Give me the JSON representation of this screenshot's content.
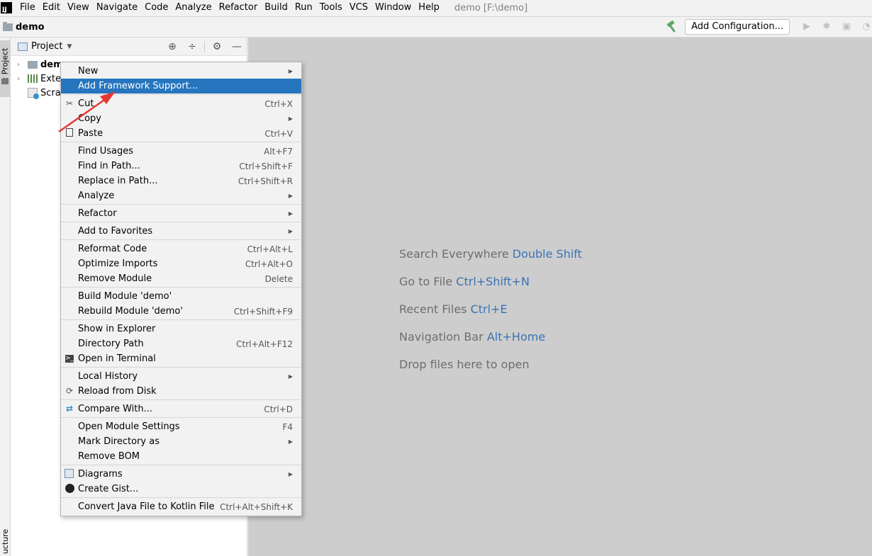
{
  "menubar": {
    "items": [
      "File",
      "Edit",
      "View",
      "Navigate",
      "Code",
      "Analyze",
      "Refactor",
      "Build",
      "Run",
      "Tools",
      "VCS",
      "Window",
      "Help"
    ],
    "window_title": "demo [F:\\demo]"
  },
  "navbar": {
    "crumb": "demo",
    "add_configuration": "Add Configuration..."
  },
  "left_strip": {
    "project_tab": "1: Project",
    "structure_tab": "ucture"
  },
  "project_panel": {
    "title": "Project",
    "tree": [
      {
        "label": "dem",
        "bold": true
      },
      {
        "label": "Exter"
      },
      {
        "label": "Scrat"
      }
    ]
  },
  "editor": {
    "hints": [
      {
        "text": "Search Everywhere",
        "key": "Double Shift"
      },
      {
        "text": "Go to File",
        "key": "Ctrl+Shift+N"
      },
      {
        "text": "Recent Files",
        "key": "Ctrl+E"
      },
      {
        "text": "Navigation Bar",
        "key": "Alt+Home"
      },
      {
        "text": "Drop files here to open",
        "key": ""
      }
    ]
  },
  "context_menu": {
    "items": [
      {
        "label": "New",
        "shortcut": "",
        "submenu": true
      },
      {
        "label": "Add Framework Support...",
        "shortcut": "",
        "selected": true
      },
      {
        "sep": true
      },
      {
        "label": "Cut",
        "shortcut": "Ctrl+X",
        "icon": "scissors-icon"
      },
      {
        "label": "Copy",
        "shortcut": "",
        "submenu": true
      },
      {
        "label": "Paste",
        "shortcut": "Ctrl+V",
        "icon": "clipboard-icon"
      },
      {
        "sep": true
      },
      {
        "label": "Find Usages",
        "shortcut": "Alt+F7"
      },
      {
        "label": "Find in Path...",
        "shortcut": "Ctrl+Shift+F"
      },
      {
        "label": "Replace in Path...",
        "shortcut": "Ctrl+Shift+R"
      },
      {
        "label": "Analyze",
        "shortcut": "",
        "submenu": true
      },
      {
        "sep": true
      },
      {
        "label": "Refactor",
        "shortcut": "",
        "submenu": true
      },
      {
        "sep": true
      },
      {
        "label": "Add to Favorites",
        "shortcut": "",
        "submenu": true
      },
      {
        "sep": true
      },
      {
        "label": "Reformat Code",
        "shortcut": "Ctrl+Alt+L"
      },
      {
        "label": "Optimize Imports",
        "shortcut": "Ctrl+Alt+O"
      },
      {
        "label": "Remove Module",
        "shortcut": "Delete"
      },
      {
        "sep": true
      },
      {
        "label": "Build Module 'demo'",
        "shortcut": ""
      },
      {
        "label": "Rebuild Module 'demo'",
        "shortcut": "Ctrl+Shift+F9"
      },
      {
        "sep": true
      },
      {
        "label": "Show in Explorer",
        "shortcut": ""
      },
      {
        "label": "Directory Path",
        "shortcut": "Ctrl+Alt+F12"
      },
      {
        "label": "Open in Terminal",
        "shortcut": "",
        "icon": "terminal-icon"
      },
      {
        "sep": true
      },
      {
        "label": "Local History",
        "shortcut": "",
        "submenu": true
      },
      {
        "label": "Reload from Disk",
        "shortcut": "",
        "icon": "reload-icon"
      },
      {
        "sep": true
      },
      {
        "label": "Compare With...",
        "shortcut": "Ctrl+D",
        "icon": "compare-icon"
      },
      {
        "sep": true
      },
      {
        "label": "Open Module Settings",
        "shortcut": "F4"
      },
      {
        "label": "Mark Directory as",
        "shortcut": "",
        "submenu": true
      },
      {
        "label": "Remove BOM",
        "shortcut": ""
      },
      {
        "sep": true
      },
      {
        "label": "Diagrams",
        "shortcut": "",
        "submenu": true,
        "icon": "diagram-icon"
      },
      {
        "label": "Create Gist...",
        "shortcut": "",
        "icon": "github-icon"
      },
      {
        "sep": true
      },
      {
        "label": "Convert Java File to Kotlin File",
        "shortcut": "Ctrl+Alt+Shift+K"
      }
    ]
  },
  "colors": {
    "selection": "#2675bf",
    "hint_key": "#3a73b3",
    "arrow": "#e53935"
  }
}
